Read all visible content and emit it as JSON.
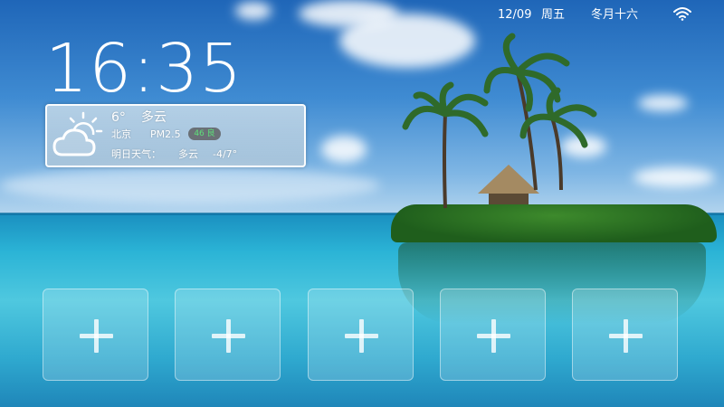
{
  "status_bar": {
    "date": "12/09",
    "weekday": "周五",
    "lunar_date": "冬月十六",
    "wifi_icon": "wifi-icon"
  },
  "clock": {
    "time": "16:35"
  },
  "weather": {
    "icon": "partly-cloudy-icon",
    "temperature": "6°",
    "condition": "多云",
    "city": "北京",
    "pm_label": "PM2.5",
    "aqi_value": "46 良",
    "aqi_color": "#5ee07a",
    "tomorrow_label": "明日天气：",
    "tomorrow_condition": "多云",
    "tomorrow_range": "-4/7°"
  },
  "app_slots": [
    {
      "icon": "plus-icon"
    },
    {
      "icon": "plus-icon"
    },
    {
      "icon": "plus-icon"
    },
    {
      "icon": "plus-icon"
    },
    {
      "icon": "plus-icon"
    }
  ]
}
